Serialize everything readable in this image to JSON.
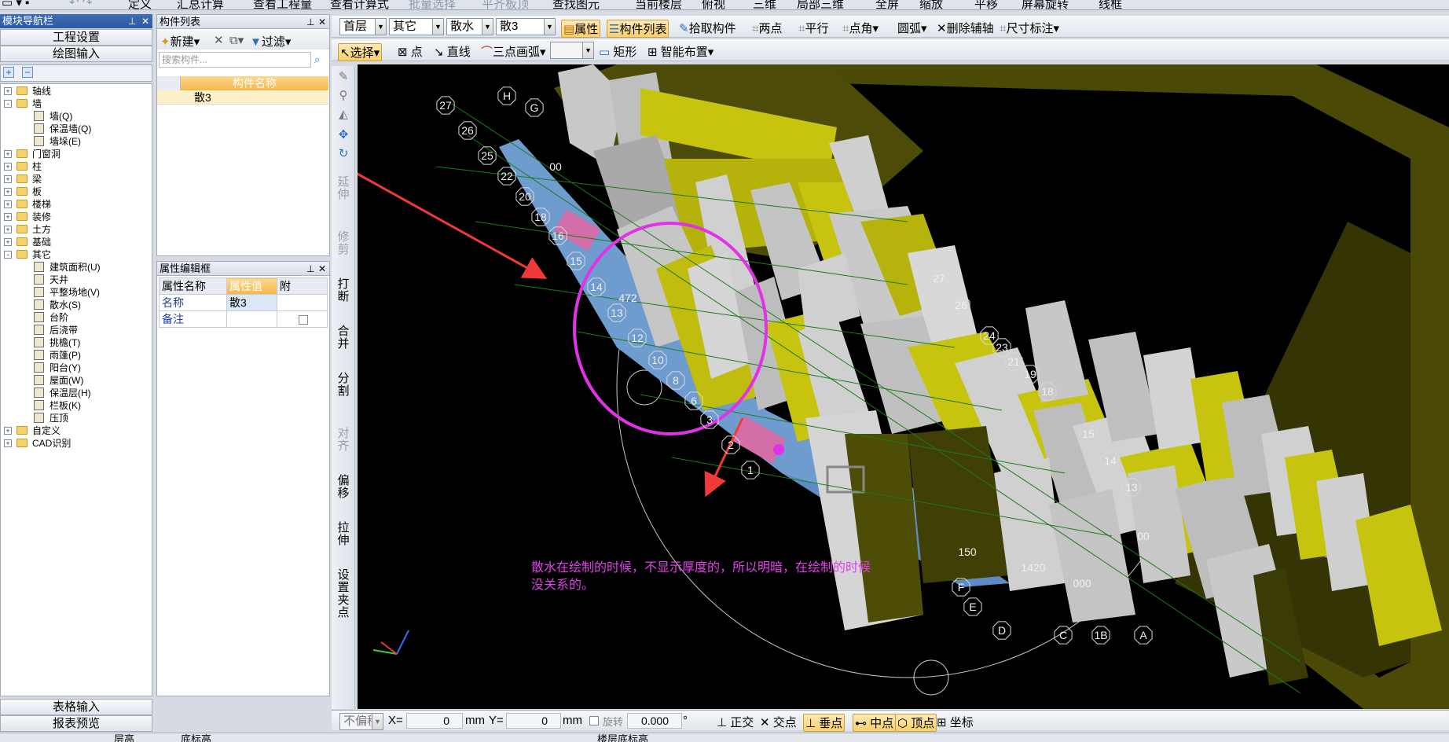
{
  "toolbar_top": {
    "define": "定义",
    "summary": "汇总计算",
    "view_quantity": "查看工程量",
    "view_formula": "查看计算式",
    "batch_select": "批量选择",
    "align_slab": "平齐板顶",
    "find_element": "查找图元",
    "current_floor": "当前楼层",
    "top_view": "俯视",
    "view_3d": "三维",
    "local_3d": "局部三维",
    "fullscreen": "全屏",
    "zoom": "缩放",
    "pan": "平移",
    "screen_rotate": "屏幕旋转",
    "wireframe": "线框"
  },
  "nav": {
    "title": "模块导航栏",
    "project_settings": "工程设置",
    "drawing_input": "绘图输入",
    "table_input": "表格输入",
    "report_preview": "报表预览"
  },
  "tree": [
    {
      "label": "轴线",
      "level": 0,
      "kind": "folder",
      "exp": "+"
    },
    {
      "label": "墙",
      "level": 0,
      "kind": "folder",
      "exp": "-"
    },
    {
      "label": "墙(Q)",
      "level": 1,
      "kind": "item"
    },
    {
      "label": "保温墙(Q)",
      "level": 1,
      "kind": "item"
    },
    {
      "label": "墙垛(E)",
      "level": 1,
      "kind": "item"
    },
    {
      "label": "门窗洞",
      "level": 0,
      "kind": "folder",
      "exp": "+"
    },
    {
      "label": "柱",
      "level": 0,
      "kind": "folder",
      "exp": "+"
    },
    {
      "label": "梁",
      "level": 0,
      "kind": "folder",
      "exp": "+"
    },
    {
      "label": "板",
      "level": 0,
      "kind": "folder",
      "exp": "+"
    },
    {
      "label": "楼梯",
      "level": 0,
      "kind": "folder",
      "exp": "+"
    },
    {
      "label": "装修",
      "level": 0,
      "kind": "folder",
      "exp": "+"
    },
    {
      "label": "土方",
      "level": 0,
      "kind": "folder",
      "exp": "+"
    },
    {
      "label": "基础",
      "level": 0,
      "kind": "folder",
      "exp": "+"
    },
    {
      "label": "其它",
      "level": 0,
      "kind": "folder",
      "exp": "-"
    },
    {
      "label": "建筑面积(U)",
      "level": 1,
      "kind": "item"
    },
    {
      "label": "天井",
      "level": 1,
      "kind": "item"
    },
    {
      "label": "平整场地(V)",
      "level": 1,
      "kind": "item"
    },
    {
      "label": "散水(S)",
      "level": 1,
      "kind": "item"
    },
    {
      "label": "台阶",
      "level": 1,
      "kind": "item"
    },
    {
      "label": "后浇带",
      "level": 1,
      "kind": "item"
    },
    {
      "label": "挑檐(T)",
      "level": 1,
      "kind": "item"
    },
    {
      "label": "雨篷(P)",
      "level": 1,
      "kind": "item"
    },
    {
      "label": "阳台(Y)",
      "level": 1,
      "kind": "item"
    },
    {
      "label": "屋面(W)",
      "level": 1,
      "kind": "item"
    },
    {
      "label": "保温层(H)",
      "level": 1,
      "kind": "item"
    },
    {
      "label": "栏板(K)",
      "level": 1,
      "kind": "item"
    },
    {
      "label": "压顶",
      "level": 1,
      "kind": "item"
    },
    {
      "label": "自定义",
      "level": 0,
      "kind": "folder",
      "exp": "+"
    },
    {
      "label": "CAD识别",
      "level": 0,
      "kind": "folder",
      "exp": "+"
    }
  ],
  "component_list": {
    "title": "构件列表",
    "new": "新建",
    "filter": "过滤",
    "search_placeholder": "搜索构件...",
    "col_name": "构件名称",
    "row_name": "散3"
  },
  "property_panel": {
    "title": "属性编辑框",
    "col_name": "属性名称",
    "col_value": "属性值",
    "col_attach": "附",
    "rows": [
      {
        "name": "名称",
        "value": "散3"
      },
      {
        "name": "备注",
        "value": ""
      }
    ]
  },
  "toolbar_row1": {
    "floor": "首层",
    "category": "其它",
    "type": "散水",
    "element": "散3",
    "properties": "属性",
    "component_list": "构件列表",
    "pick": "拾取构件",
    "two_points": "两点",
    "parallel": "平行",
    "point_angle": "点角",
    "arc": "圆弧",
    "delete_aux": "删除辅轴",
    "dim": "尺寸标注"
  },
  "toolbar_row2": {
    "select": "选择",
    "point": "点",
    "line": "直线",
    "three_point_arc": "三点画弧",
    "rect": "矩形",
    "smart_layout": "智能布置"
  },
  "vtools": [
    "延伸",
    "修剪",
    "打断",
    "合并",
    "分割",
    "对齐",
    "偏移",
    "拉伸",
    "设置夹点"
  ],
  "status": {
    "no_offset": "不偏移",
    "x_label": "X=",
    "x_val": "0",
    "unit": "mm",
    "y_label": "Y=",
    "y_val": "0",
    "rotate": "旋转",
    "rotate_val": "0.000",
    "deg": "°",
    "ortho": "正交",
    "intersect": "交点",
    "perp": "垂点",
    "midpoint": "中点",
    "vertex": "顶点",
    "coords": "坐标"
  },
  "bottom": {
    "a": "层高",
    "b": "底标高",
    "c": "楼层底标高"
  },
  "annotation": {
    "line1": "散水在绘制的时候，不显示厚度的，所以明暗，在绘制的时候",
    "line2": "没关系的。"
  },
  "axis_labels": [
    "27",
    "26",
    "25",
    "22",
    "20",
    "18",
    "16",
    "15",
    "14",
    "13",
    "12",
    "10",
    "8",
    "6",
    "3",
    "2",
    "1",
    "H",
    "G",
    "F",
    "E",
    "D",
    "C",
    "1B",
    "A",
    "27",
    "26",
    "24",
    "23",
    "21",
    "19",
    "18",
    "15",
    "14",
    "13",
    "472",
    "00",
    "150",
    "1420",
    "000",
    "00"
  ]
}
